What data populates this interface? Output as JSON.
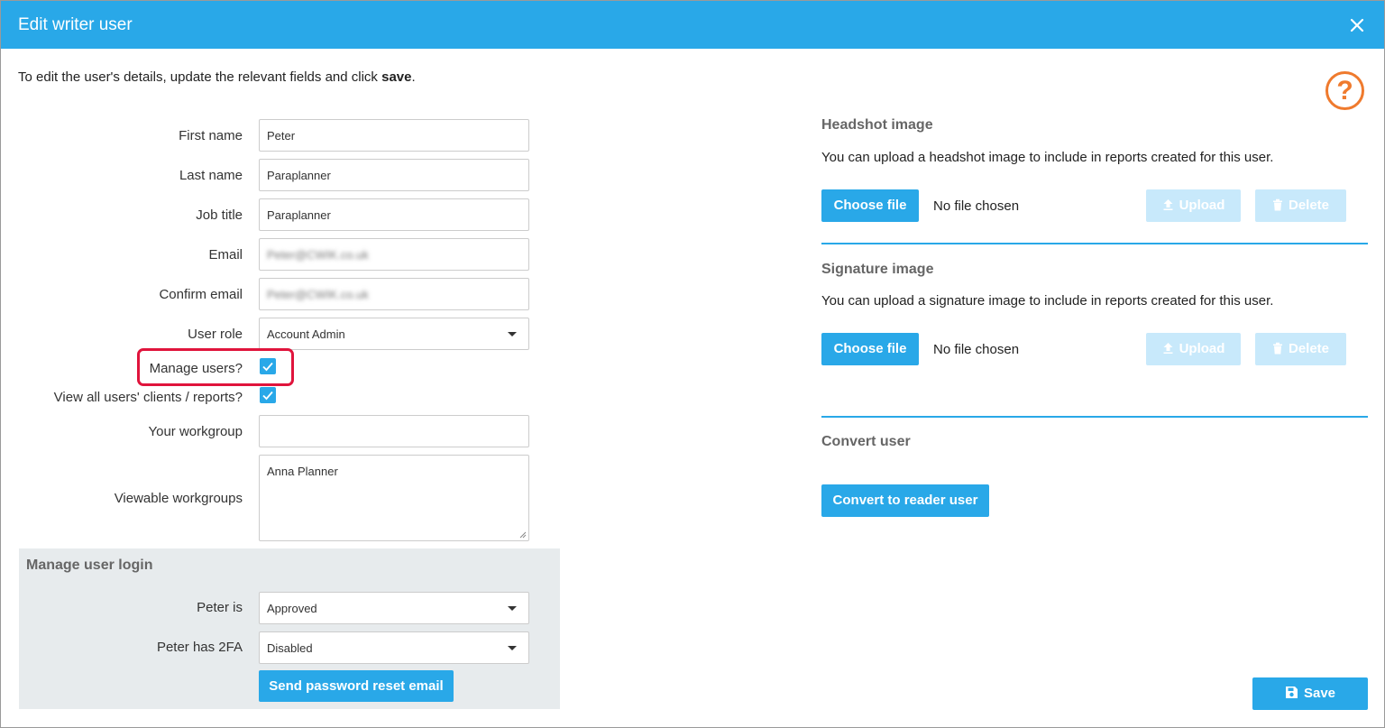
{
  "dialog": {
    "title": "Edit writer user",
    "intro_text": "To edit the user's details, update the relevant fields and click ",
    "intro_bold": "save",
    "intro_end": ".",
    "help_glyph": "?"
  },
  "form": {
    "first_name": {
      "label": "First name",
      "value": "Peter"
    },
    "last_name": {
      "label": "Last name",
      "value": "Paraplanner"
    },
    "job_title": {
      "label": "Job title",
      "value": "Paraplanner"
    },
    "email": {
      "label": "Email",
      "value": "Peter@CWIK.co.uk"
    },
    "confirm_email": {
      "label": "Confirm email",
      "value": "Peter@CWIK.co.uk"
    },
    "user_role": {
      "label": "User role",
      "value": "Account Admin"
    },
    "manage_users": {
      "label": "Manage users?",
      "checked": true
    },
    "view_all": {
      "label": "View all users' clients / reports?",
      "checked": true
    },
    "your_workgroup": {
      "label": "Your workgroup",
      "value": ""
    },
    "viewable_workgroups": {
      "label": "Viewable workgroups",
      "value": "Anna Planner"
    }
  },
  "login": {
    "title": "Manage user login",
    "status": {
      "label": "Peter is",
      "value": "Approved"
    },
    "twofa": {
      "label": "Peter has 2FA",
      "value": "Disabled"
    },
    "reset_button": "Send password reset email"
  },
  "headshot": {
    "title": "Headshot image",
    "desc": "You can upload a headshot image to include in reports created for this user.",
    "choose": "Choose file",
    "nofile": "No file chosen",
    "upload": "Upload",
    "delete": "Delete"
  },
  "signature": {
    "title": "Signature image",
    "desc": "You can upload a signature image to include in reports created for this user.",
    "choose": "Choose file",
    "nofile": "No file chosen",
    "upload": "Upload",
    "delete": "Delete"
  },
  "convert": {
    "title": "Convert user",
    "button": "Convert to reader user"
  },
  "footer": {
    "save": "Save"
  },
  "colors": {
    "primary": "#29a8e8",
    "disabled": "#c8e9fb",
    "help": "#ef7a2d",
    "highlight": "#e0143c",
    "panel": "#e7ebed"
  }
}
